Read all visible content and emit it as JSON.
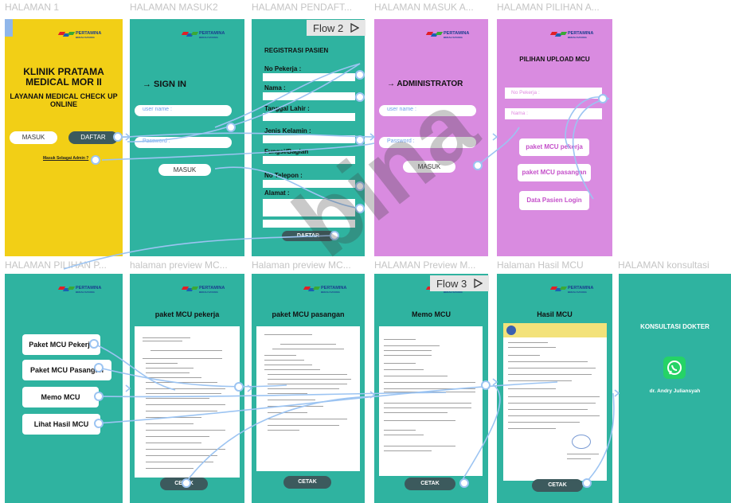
{
  "frames_top": [
    {
      "title": "HALAMAN 1"
    },
    {
      "title": "HALAMAN MASUK2"
    },
    {
      "title": "HALAMAN PENDAFT..."
    },
    {
      "title": "HALAMAN MASUK A..."
    },
    {
      "title": "HALAMAN PILIHAN A..."
    }
  ],
  "frames_bottom": [
    {
      "title": "HALAMAN PILIHAN P..."
    },
    {
      "title": "halaman preview MC..."
    },
    {
      "title": "Halaman preview MC..."
    },
    {
      "title": "HALAMAN Preview M..."
    },
    {
      "title": "Halaman Hasil MCU"
    },
    {
      "title": "HALAMAN konsultasi"
    }
  ],
  "logo": {
    "name": "PERTAMINA",
    "sub": "BEDAH SAYANG"
  },
  "home": {
    "title": "KLINIK PRATAMA MEDICAL MOR II",
    "subtitle": "LAYANAN MEDICAL CHECK UP ONLINE",
    "masuk": "MASUK",
    "daftar": "DAFTAR",
    "admin_link": "Masuk Sebagai Admin ?"
  },
  "signin": {
    "heading": "→ SIGN IN",
    "username_placeholder": "user name :",
    "password_placeholder": "Password :",
    "button": "MASUK"
  },
  "register": {
    "heading": "REGISTRASI PASIEN",
    "fields": [
      "No Pekerja :",
      "Nama :",
      "Tanggal Lahir :",
      "Jenis Kelamin :",
      "Fungsi/Bagian",
      "No Telepon :",
      "Alamat :"
    ],
    "button": "DAFTAR"
  },
  "admin_login": {
    "heading": "→ ADMINISTRATOR",
    "username_placeholder": "user name :",
    "password_placeholder": "Password :",
    "button": "MASUK"
  },
  "admin_choice": {
    "heading": "PILIHAN UPLOAD MCU",
    "no_pekerja": "No Pekerja :",
    "nama": "Nama :",
    "options": [
      "paket MCU pekerja",
      "paket MCU pasangan",
      "Data Pasien Login"
    ]
  },
  "patient_menu": {
    "options": [
      "Paket MCU Pekerja",
      "Paket MCU Pasangan",
      "Memo MCU",
      "Lihat Hasil MCU"
    ]
  },
  "preview_pekerja": {
    "heading": "paket MCU pekerja",
    "button": "CETAK"
  },
  "preview_pasangan": {
    "heading": "paket MCU pasangan",
    "button": "CETAK"
  },
  "preview_memo": {
    "heading": "Memo MCU",
    "button": "CETAK"
  },
  "hasil": {
    "heading": "Hasil MCU",
    "button": "CETAK"
  },
  "konsultasi": {
    "heading": "KONSULTASI DOKTER",
    "doctor": "dr. Andry Juliansyah"
  },
  "flows": {
    "flow2": "Flow 2",
    "flow3": "Flow 3"
  },
  "colors": {
    "yellow": "#f2cf16",
    "teal": "#2fb3a0",
    "pink": "#d98be0",
    "wire": "#9cc4f2",
    "dark_button": "#3c5a5d"
  }
}
